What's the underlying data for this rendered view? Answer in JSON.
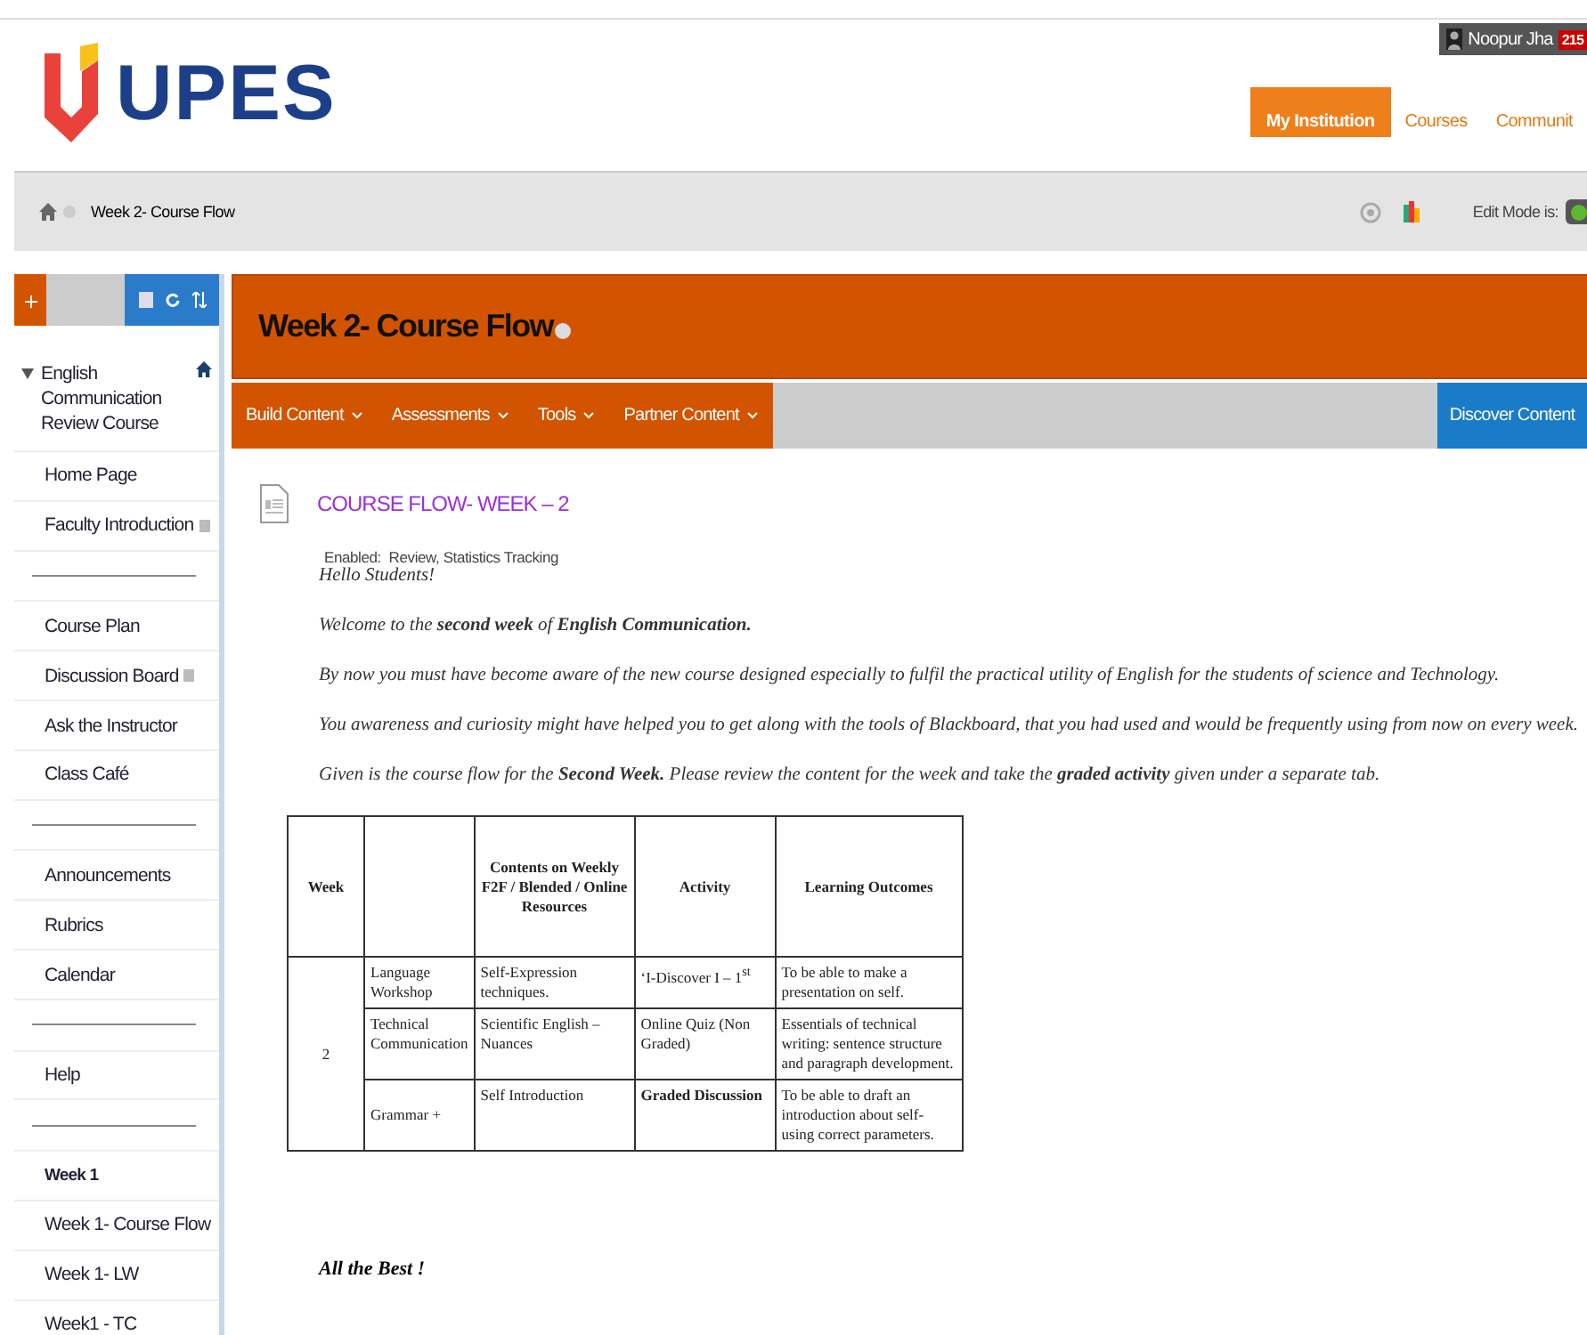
{
  "header": {
    "logo_text": "UPES",
    "user": {
      "name": "Noopur Jha",
      "count": "215"
    },
    "tabs": [
      {
        "label": "My Institution",
        "selected": true
      },
      {
        "label": "Courses",
        "selected": false
      },
      {
        "label": "Communit",
        "selected": false
      }
    ]
  },
  "breadcrumb": {
    "current": "Week 2- Course Flow",
    "edit_mode": {
      "label": "Edit Mode is:",
      "on": true
    }
  },
  "sidebar": {
    "items": [
      {
        "kind": "course",
        "label": "English Communication Review Course",
        "expanded": true
      },
      {
        "kind": "link",
        "label": "Home Page",
        "hidden_mark": false
      },
      {
        "kind": "link",
        "label": "Faculty Introduction",
        "hidden_mark": true
      },
      {
        "kind": "divider"
      },
      {
        "kind": "link",
        "label": "Course Plan",
        "hidden_mark": false
      },
      {
        "kind": "link",
        "label": "Discussion Board",
        "hidden_mark": true
      },
      {
        "kind": "link",
        "label": "Ask the Instructor",
        "hidden_mark": false
      },
      {
        "kind": "link",
        "label": "Class Café",
        "hidden_mark": false
      },
      {
        "kind": "divider"
      },
      {
        "kind": "link",
        "label": "Announcements",
        "hidden_mark": false
      },
      {
        "kind": "link",
        "label": "Rubrics",
        "hidden_mark": false
      },
      {
        "kind": "link",
        "label": "Calendar",
        "hidden_mark": false
      },
      {
        "kind": "divider"
      },
      {
        "kind": "link",
        "label": "Help",
        "hidden_mark": false
      },
      {
        "kind": "divider"
      },
      {
        "kind": "heading",
        "label": "Week 1"
      },
      {
        "kind": "link",
        "label": "Week 1- Course Flow",
        "hidden_mark": false
      },
      {
        "kind": "link",
        "label": "Week 1- LW",
        "hidden_mark": false
      },
      {
        "kind": "link",
        "label": "Week1 - TC",
        "hidden_mark": false
      }
    ]
  },
  "page": {
    "title": "Week 2- Course Flow",
    "menu": [
      {
        "label": "Build Content"
      },
      {
        "label": "Assessments"
      },
      {
        "label": "Tools"
      },
      {
        "label": "Partner Content"
      }
    ],
    "discover": "Discover Content",
    "item": {
      "title": "COURSE FLOW- WEEK – 2",
      "enabled_label": "Enabled:",
      "enabled_value": "Review, Statistics Tracking"
    },
    "greeting": "Hello Students!",
    "paragraphs": [
      "Welcome to the **second week** of **English Communication.**",
      "By now you must have become aware of the new course designed especially to fulfil the practical utility of English for the students of science and Technology.",
      "You awareness and curiosity might have helped you to get along with the tools of Blackboard, that you had used and would be frequently using from now on every week.",
      "Given is the course flow for the **Second Week.** Please review the content for the week and take the **graded activity** given under a separate tab."
    ],
    "table": {
      "columns": [
        {
          "label": "Week"
        },
        {},
        {
          "label": "Contents on Weekly F2F / Blended / Online Resources"
        },
        {
          "label": "Activity"
        },
        {
          "label": "Learning Outcomes"
        }
      ],
      "week": "2",
      "rows": [
        {
          "strand": "Language Workshop",
          "content": "Self-Expression techniques.",
          "activity": "‘I-Discover I – 1$^{st}$",
          "activity_bold": false,
          "outcome": "To be able to make a presentation on self."
        },
        {
          "strand": "Technical Communication",
          "content": "Scientific English – Nuances",
          "activity": "Online Quiz (Non Graded)",
          "activity_bold": false,
          "outcome": "Essentials of technical writing: sentence structure and paragraph development."
        },
        {
          "strand": "Grammar +",
          "content": "Self Introduction",
          "activity": "Graded Discussion",
          "activity_bold": true,
          "outcome": "To be able to draft an introduction about self-using correct parameters."
        }
      ]
    },
    "closing": "All the Best !"
  }
}
